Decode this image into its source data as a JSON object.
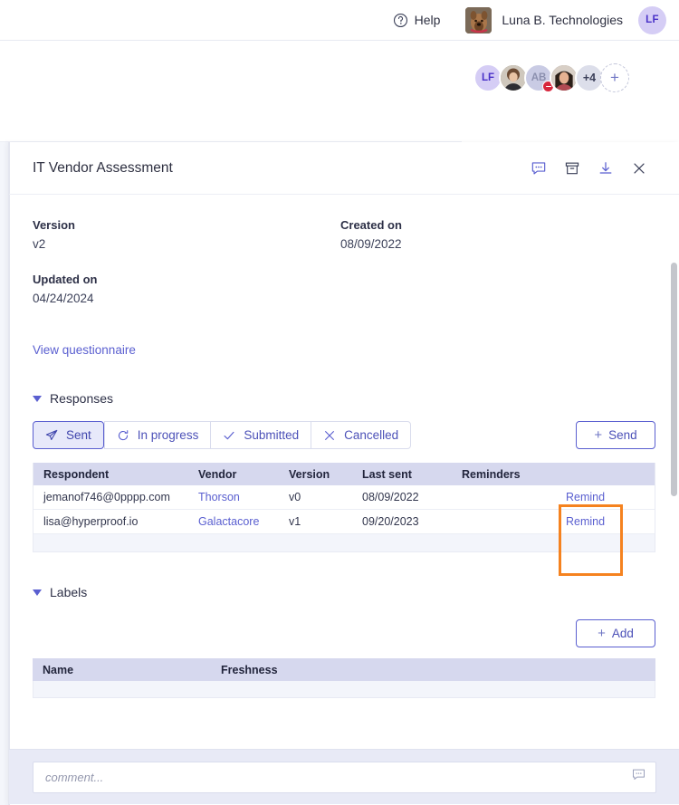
{
  "topbar": {
    "help_label": "Help",
    "help_icon": "question-circle-icon",
    "org_name": "Luna B. Technologies",
    "user_initials": "LF"
  },
  "collaborators": {
    "items": [
      {
        "type": "initials",
        "label": "LF"
      },
      {
        "type": "photo",
        "label": ""
      },
      {
        "type": "initials",
        "label": "AB",
        "badge": "remove-badge"
      },
      {
        "type": "photo",
        "label": ""
      },
      {
        "type": "overflow",
        "label": "+4"
      }
    ],
    "add_label": "+"
  },
  "drawer": {
    "title": "IT Vendor Assessment",
    "actions": [
      {
        "name": "comment-icon",
        "label": "Comment"
      },
      {
        "name": "archive-icon",
        "label": "Archive"
      },
      {
        "name": "download-icon",
        "label": "Download"
      },
      {
        "name": "close-icon",
        "label": "Close"
      }
    ],
    "meta": {
      "version_label": "Version",
      "version_value": "v2",
      "created_label": "Created on",
      "created_value": "08/09/2022",
      "updated_label": "Updated on",
      "updated_value": "04/24/2024"
    },
    "view_questionnaire": "View questionnaire",
    "responses": {
      "section_title": "Responses",
      "filters": [
        {
          "label": "Sent",
          "icon": "paper-plane-icon",
          "active": true
        },
        {
          "label": "In progress",
          "icon": "refresh-icon",
          "active": false
        },
        {
          "label": "Submitted",
          "icon": "check-icon",
          "active": false
        },
        {
          "label": "Cancelled",
          "icon": "x-icon",
          "active": false
        }
      ],
      "send_button": "Send",
      "columns": [
        "Respondent",
        "Vendor",
        "Version",
        "Last sent",
        "Reminders",
        ""
      ],
      "rows": [
        {
          "respondent": "jemanof746@0pppp.com",
          "vendor": "Thorson",
          "version": "v0",
          "last_sent": "08/09/2022",
          "reminders": "",
          "action": "Remind"
        },
        {
          "respondent": "lisa@hyperproof.io",
          "vendor": "Galactacore",
          "version": "v1",
          "last_sent": "09/20/2023",
          "reminders": "",
          "action": "Remind"
        }
      ]
    },
    "labels": {
      "section_title": "Labels",
      "add_button": "Add",
      "columns": [
        "Name",
        "Freshness"
      ],
      "rows": []
    },
    "comment": {
      "placeholder": "comment...",
      "icon": "comment-icon"
    }
  },
  "colors": {
    "accent": "#5a5fd0",
    "highlight": "#f5821f",
    "table_header_bg": "#d6d8ee",
    "avatar_bg": "#d5cdf5"
  }
}
